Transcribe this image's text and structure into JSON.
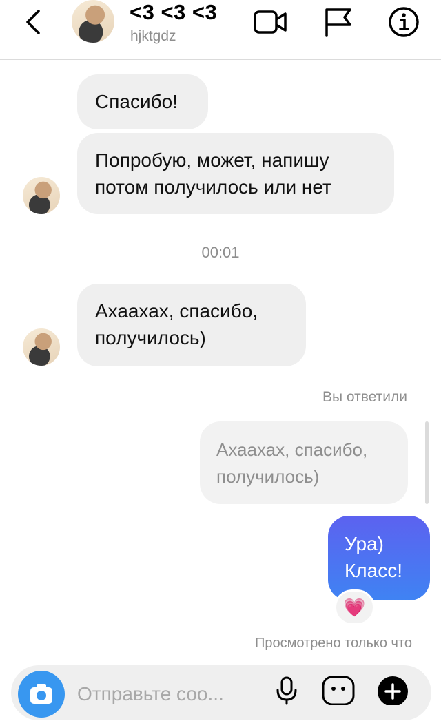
{
  "header": {
    "title": "<3 <3 <3",
    "username": "hjktgdz"
  },
  "messages": {
    "incoming": [
      "Спасибо!",
      "Попробую, может, напишу потом получилось или нет",
      "Ахаахах, спасибо, получилось)"
    ],
    "timestamp": "00:01",
    "reply_label": "Вы ответили",
    "quoted_text": "Ахаахах, спасибо, получилось)",
    "outgoing": "Ура) Класс!",
    "reaction": "💗",
    "seen_status": "Просмотрено только что"
  },
  "composer": {
    "placeholder": "Отправьте соо..."
  },
  "colors": {
    "incoming_bubble": "#efefef",
    "outgoing_gradient_top": "#5c62f0",
    "outgoing_gradient_bottom": "#3f83f3",
    "camera_button": "#3897f0",
    "secondary_text": "#8e8e8e"
  },
  "icons": {
    "back": "chevron-left-icon",
    "video": "video-camera-icon",
    "report": "flag-icon",
    "info": "info-icon",
    "camera": "camera-icon",
    "mic": "microphone-icon",
    "sticker": "sticker-icon",
    "add": "plus-icon"
  }
}
